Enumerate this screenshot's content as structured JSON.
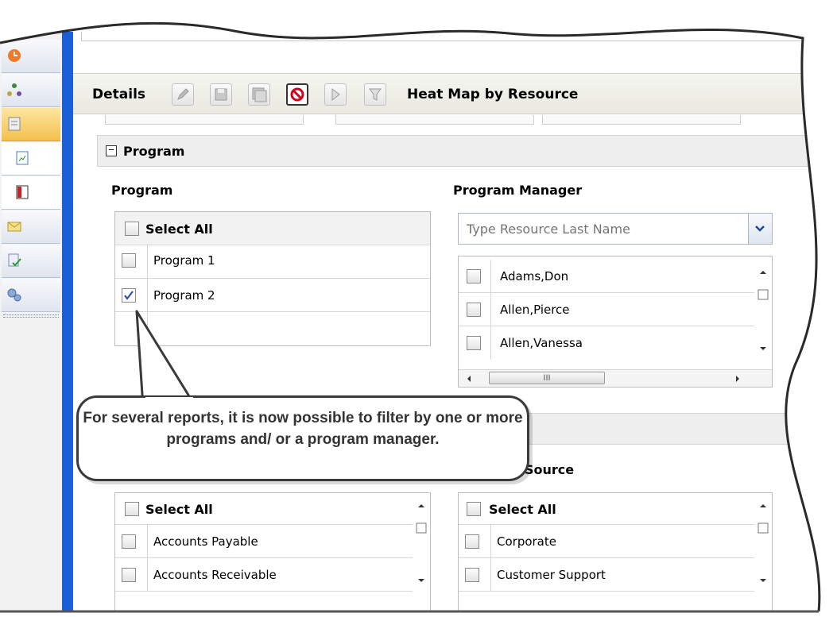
{
  "toolbar": {
    "title": "Details",
    "report_name": "Heat Map by Resource",
    "buttons": [
      "edit-icon",
      "save-icon",
      "save-as-icon",
      "cancel-icon",
      "run-icon",
      "filter-icon"
    ]
  },
  "section": {
    "toggle": "−",
    "title": "Program"
  },
  "program": {
    "label": "Program",
    "select_all": "Select All",
    "items": [
      {
        "label": "Program 1",
        "checked": false
      },
      {
        "label": "Program 2",
        "checked": true
      }
    ]
  },
  "program_manager": {
    "label": "Program Manager",
    "placeholder": "Type Resource Last Name",
    "items": [
      "Adams,Don",
      "Allen,Pierce",
      "Allen,Vanessa"
    ],
    "hscroll_grip": "III"
  },
  "callout": {
    "text": "For several reports, it is now possible to filter by one or more programs and/ or a program manager."
  },
  "funding": {
    "label_partial": "Source",
    "select_all": "Select All",
    "items": [
      "Accounts Payable",
      "Accounts Receivable"
    ]
  },
  "source": {
    "select_all": "Select All",
    "items": [
      "Corporate",
      "Customer Support"
    ]
  },
  "colors": {
    "accent": "#1b5fd8",
    "nav_active": "#f4c04c",
    "cancel": "#d0021b"
  }
}
